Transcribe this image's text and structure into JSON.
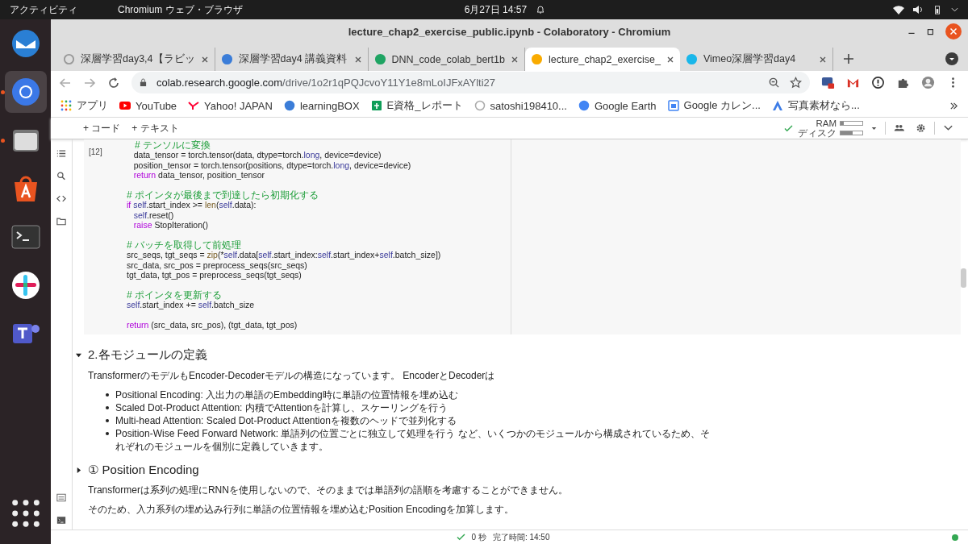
{
  "topbar": {
    "activities": "アクティビティ",
    "app_menu": "Chromium ウェブ・ブラウザ",
    "clock": "6月27日 14:57"
  },
  "dock": [
    {
      "kind": "mail",
      "running": false,
      "selected": false
    },
    {
      "kind": "browser",
      "running": true,
      "selected": true
    },
    {
      "kind": "files",
      "running": true,
      "selected": false
    },
    {
      "kind": "store",
      "running": false,
      "selected": false
    },
    {
      "kind": "terminal",
      "running": false,
      "selected": false
    },
    {
      "kind": "chat",
      "running": false,
      "selected": false
    },
    {
      "kind": "teams",
      "running": false,
      "selected": false
    },
    {
      "kind": "grid",
      "running": false,
      "selected": false
    }
  ],
  "window": {
    "title": "lecture_chap2_exercise_public.ipynb - Colaboratory - Chromium"
  },
  "tabs": [
    {
      "label": "深層学習day3,4【ラビッ",
      "kind": "face",
      "selected": false
    },
    {
      "label": "深層学習day4 講義資料",
      "kind": "lb",
      "selected": false
    },
    {
      "label": "DNN_code_colab_bert1b",
      "kind": "drive",
      "selected": false
    },
    {
      "label": "lecture_chap2_exercise_",
      "kind": "colab",
      "selected": true
    },
    {
      "label": "Vimeo深層学習day4",
      "kind": "vimeo",
      "selected": false
    }
  ],
  "address": {
    "host": "colab.research.google.com",
    "path": "/drive/1o2r1qPQJcvoY11Y1e8mLoIJFxAYlti27"
  },
  "bookmarks": [
    {
      "label": "アプリ",
      "kind": "apps"
    },
    {
      "label": "YouTube",
      "kind": "youtube"
    },
    {
      "label": "Yahoo! JAPAN",
      "kind": "yahoo"
    },
    {
      "label": "learningBOX",
      "kind": "lb"
    },
    {
      "label": "E資格_レポート",
      "kind": "sheet"
    },
    {
      "label": "satoshi198410...",
      "kind": "face"
    },
    {
      "label": "Google Earth",
      "kind": "earth"
    },
    {
      "label": "Google カレン...",
      "kind": "calendar"
    },
    {
      "label": "写真素材なら...",
      "kind": "photo"
    }
  ],
  "colab": {
    "add_buttons": [
      "+ コード",
      "+ テキスト"
    ],
    "ram_label": "RAM",
    "disk_label": "ディスク",
    "ram": {
      "level": 0.15
    },
    "disk": {
      "level": 0.55
    }
  },
  "cell": {
    "count": "[12]",
    "blocks": [
      [
        {
          "tokens": [
            {
              "text": "   # テンソルに変換",
              "kind": "comment"
            }
          ]
        },
        {
          "tokens": [
            {
              "text": "   data_tensor = torch.tensor(data, dtype=torch.",
              "kind": "plain"
            },
            {
              "text": "long",
              "kind": "name"
            },
            {
              "text": ", device=device)",
              "kind": "plain"
            }
          ]
        },
        {
          "tokens": [
            {
              "text": "   position_tensor = torch.tensor(positions, dtype=torch.",
              "kind": "plain"
            },
            {
              "text": "long",
              "kind": "name"
            },
            {
              "text": ", device=device)",
              "kind": "plain"
            }
          ]
        },
        {
          "tokens": [
            {
              "text": "   return",
              "kind": "keyword"
            },
            {
              "text": " data_tensor, position_tensor",
              "kind": "plain"
            }
          ]
        }
      ],
      [
        {
          "tokens": [
            {
              "text": "# ポインタが最後まで到達したら初期化する",
              "kind": "comment"
            }
          ]
        },
        {
          "tokens": [
            {
              "text": "if",
              "kind": "keyword"
            },
            {
              "text": " self",
              "kind": "name"
            },
            {
              "text": ".start_index >= ",
              "kind": "plain"
            },
            {
              "text": "len",
              "kind": "builtin"
            },
            {
              "text": "(",
              "kind": "plain"
            },
            {
              "text": "self",
              "kind": "name"
            },
            {
              "text": ".data):",
              "kind": "plain"
            }
          ]
        },
        {
          "tokens": [
            {
              "text": "   self",
              "kind": "name"
            },
            {
              "text": ".reset()",
              "kind": "plain"
            }
          ]
        },
        {
          "tokens": [
            {
              "text": "   raise",
              "kind": "keyword"
            },
            {
              "text": " StopIteration()",
              "kind": "plain"
            }
          ]
        }
      ],
      [
        {
          "tokens": [
            {
              "text": "# バッチを取得して前処理",
              "kind": "comment"
            }
          ]
        },
        {
          "tokens": [
            {
              "text": "src_seqs, tgt_seqs = ",
              "kind": "plain"
            },
            {
              "text": "zip",
              "kind": "builtin"
            },
            {
              "text": "(*",
              "kind": "plain"
            },
            {
              "text": "self",
              "kind": "name"
            },
            {
              "text": ".data[",
              "kind": "plain"
            },
            {
              "text": "self",
              "kind": "name"
            },
            {
              "text": ".start_index:",
              "kind": "plain"
            },
            {
              "text": "self",
              "kind": "name"
            },
            {
              "text": ".start_index+",
              "kind": "plain"
            },
            {
              "text": "self",
              "kind": "name"
            },
            {
              "text": ".batch_size])",
              "kind": "plain"
            }
          ]
        },
        {
          "tokens": [
            {
              "text": "src_data, src_pos = preprocess_seqs(src_seqs)",
              "kind": "plain"
            }
          ]
        },
        {
          "tokens": [
            {
              "text": "tgt_data, tgt_pos = preprocess_seqs(tgt_seqs)",
              "kind": "plain"
            }
          ]
        }
      ],
      [
        {
          "tokens": [
            {
              "text": "# ポインタを更新する",
              "kind": "comment"
            }
          ]
        },
        {
          "tokens": [
            {
              "text": "self",
              "kind": "name"
            },
            {
              "text": ".start_index += ",
              "kind": "plain"
            },
            {
              "text": "self",
              "kind": "name"
            },
            {
              "text": ".batch_size",
              "kind": "plain"
            }
          ]
        }
      ],
      [
        {
          "tokens": [
            {
              "text": "return",
              "kind": "keyword"
            },
            {
              "text": " (src_data, src_pos), (tgt_data, tgt_pos)",
              "kind": "plain"
            }
          ]
        }
      ]
    ]
  },
  "markdown": [
    {
      "kind": "heading",
      "text": "2.各モジュールの定義",
      "expanded": true
    },
    {
      "kind": "paragraph",
      "text": "TransformerのモデルもEncoder-Decoderモデルの構造になっています。 EncoderとDecoderは"
    },
    {
      "kind": "bullets",
      "items": [
        "Positional Encoding: 入出力の単語のEmbedding時に単語の位置情報を埋め込む",
        "Scaled Dot-Product Attention: 内積でAttentionを計算し、スケーリングを行う",
        "Multi-head Attention: Scaled Dot-Product Attentionを複数のヘッドで並列化する",
        "Position-Wise Feed Forward Network: 単語列の位置ごとに独立して処理を行う など、いくつかのモジュールから構成されているため、それぞれのモジュールを個別に定義していきます。"
      ]
    },
    {
      "kind": "heading",
      "text": "① Position Encoding",
      "expanded": false
    },
    {
      "kind": "paragraph",
      "text": "Transformerは系列の処理にRNNを使用しないので、そのままでは単語列の語順を考慮することができません。"
    },
    {
      "kind": "paragraph",
      "text": "そのため、入力系列の埋め込み行列に単語の位置情報を埋め込むPosition Encodingを加算します。"
    }
  ],
  "status": {
    "elapsed": "0 秒",
    "completed": "完了時間: 14:50"
  }
}
